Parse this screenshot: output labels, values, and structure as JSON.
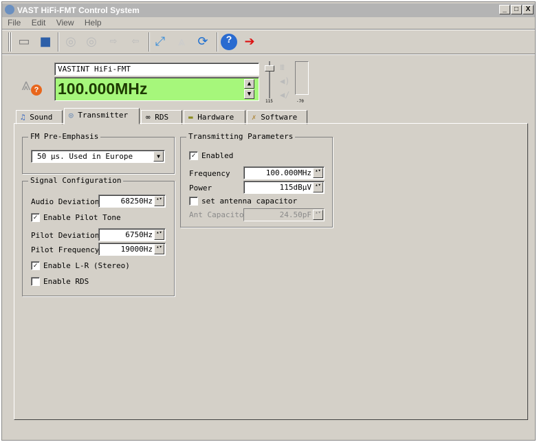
{
  "window": {
    "title": "VAST HiFi-FMT Control System",
    "controls": [
      "_",
      "□",
      "X"
    ]
  },
  "menu": [
    "File",
    "Edit",
    "View",
    "Help"
  ],
  "toolbar": {
    "icons": [
      "open-icon",
      "save-icon",
      "upload-icon",
      "download-icon",
      "forward-icon",
      "back-icon",
      "connect-icon",
      "antenna-icon",
      "refresh-icon",
      "help-icon",
      "exit-icon"
    ]
  },
  "header": {
    "device_name": "VASTINT HiFi-FMT",
    "frequency": "100.000MHz",
    "slider_min": "115",
    "level_label": "-70",
    "slider_value": 115,
    "accent": "#a6f77b"
  },
  "tabs": [
    {
      "label": "Sound",
      "icon": "music-note-icon"
    },
    {
      "label": "Transmitter",
      "icon": "antenna-icon",
      "active": true
    },
    {
      "label": "RDS",
      "icon": "rds-icon"
    },
    {
      "label": "Hardware",
      "icon": "chip-icon"
    },
    {
      "label": "Software",
      "icon": "tools-icon"
    }
  ],
  "pre_emphasis": {
    "title": "FM Pre-Emphasis",
    "selected": "50 µs. Used in Europe"
  },
  "signal": {
    "title": "Signal Configuration",
    "audio_deviation_label": "Audio Deviation",
    "audio_deviation": "68250Hz",
    "pilot_tone_label": "Enable Pilot Tone",
    "pilot_tone": true,
    "pilot_deviation_label": "Pilot Deviation",
    "pilot_deviation": "6750Hz",
    "pilot_frequency_label": "Pilot Frequency",
    "pilot_frequency": "19000Hz",
    "stereo_label": "Enable L-R (Stereo)",
    "stereo": true,
    "rds_label": "Enable RDS",
    "rds": false
  },
  "transmit": {
    "title": "Transmitting Parameters",
    "enabled_label": "Enabled",
    "enabled": true,
    "frequency_label": "Frequency",
    "frequency": "100.000MHz",
    "power_label": "Power",
    "power": "115dBµV",
    "antcap_check_label": "set antenna capacitor",
    "antcap_check": false,
    "antcap_label": "Ant Capacitor",
    "antcap": "24.50pF"
  }
}
